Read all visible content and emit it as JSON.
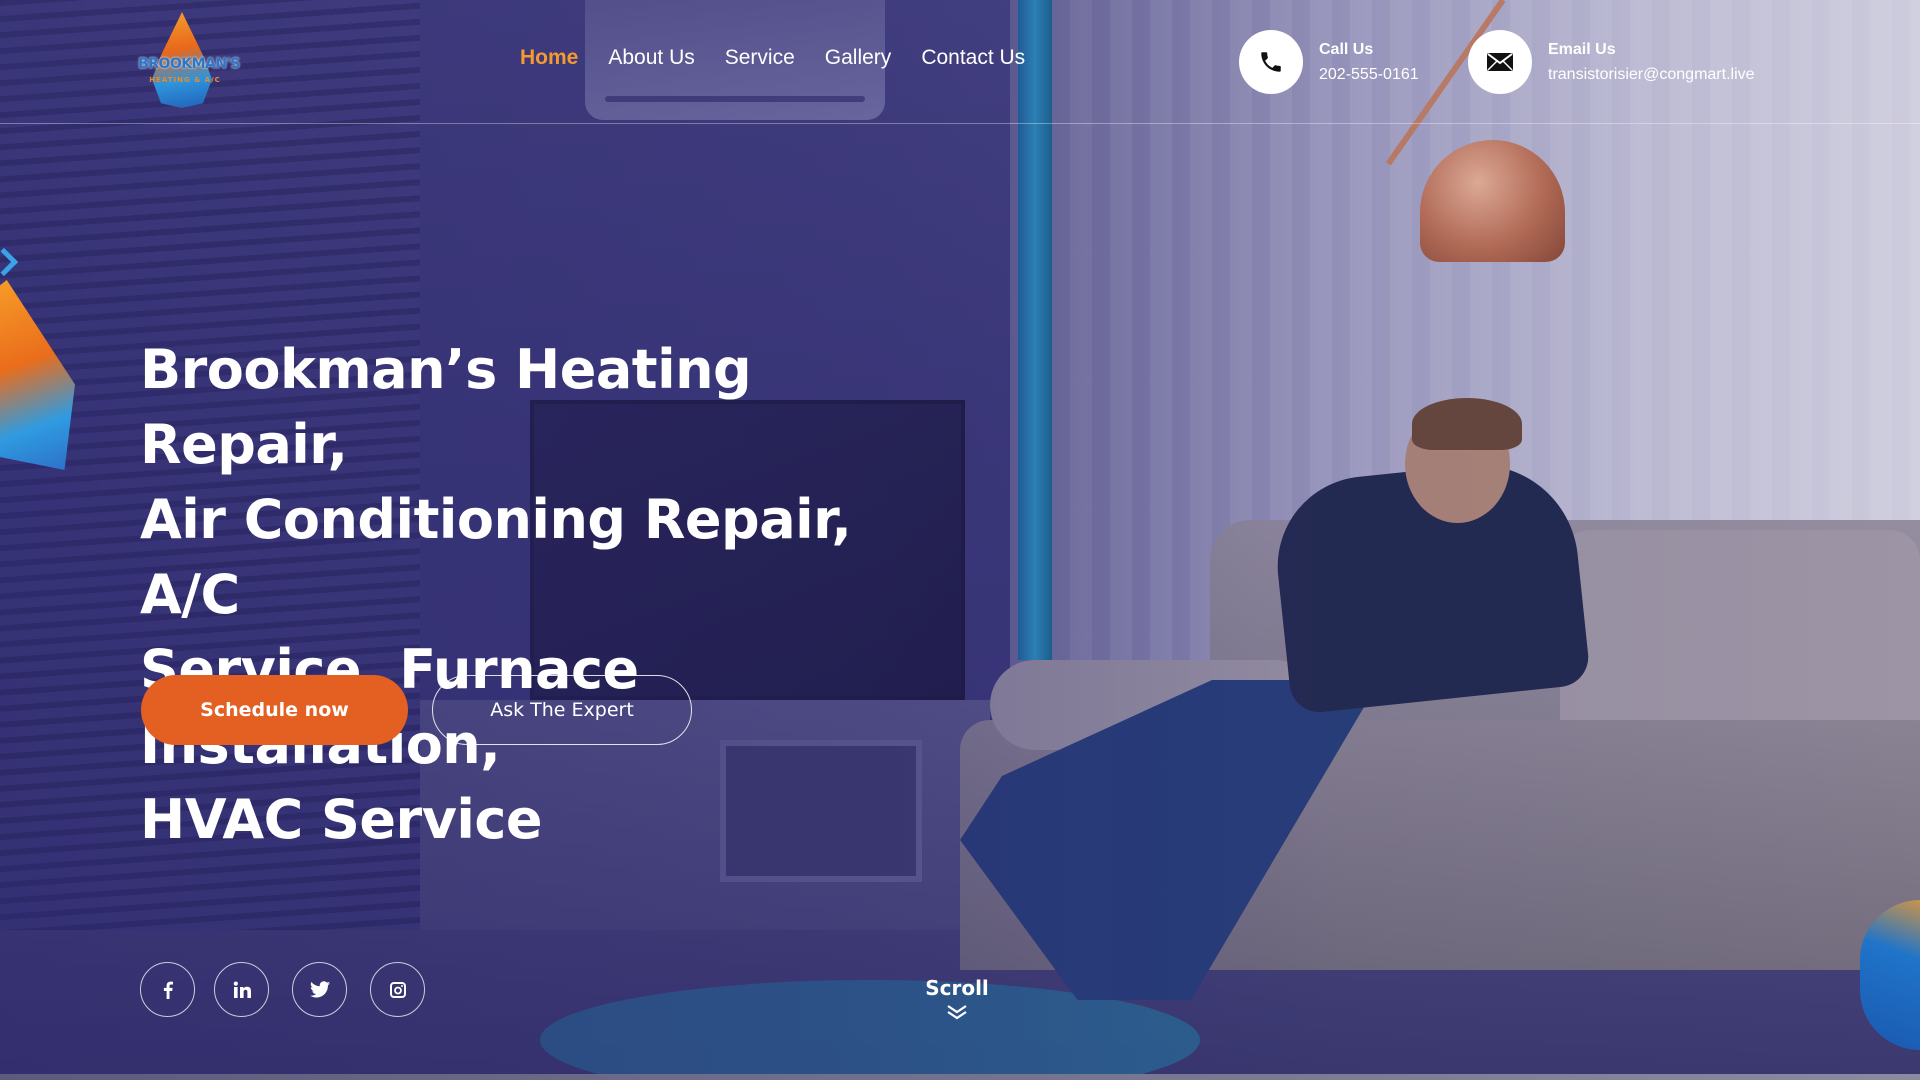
{
  "brand": {
    "logo_text": "BROOKMAN'S",
    "logo_subtext": "HEATING & A/C"
  },
  "nav": {
    "items": [
      {
        "label": "Home",
        "active": true
      },
      {
        "label": "About Us",
        "active": false
      },
      {
        "label": "Service",
        "active": false
      },
      {
        "label": "Gallery",
        "active": false
      },
      {
        "label": "Contact Us",
        "active": false
      }
    ]
  },
  "contact": {
    "call": {
      "label": "Call Us",
      "value": "202-555-0161",
      "icon": "phone-icon"
    },
    "email": {
      "label": "Email Us",
      "value": "transistorisier@congmart.live",
      "icon": "mail-icon"
    }
  },
  "hero": {
    "title_lines": [
      "Brookman’s Heating Repair,",
      "Air Conditioning Repair, A/C",
      "Service, Furnace Installation,",
      "HVAC Service"
    ],
    "primary_button": "Schedule now",
    "secondary_button": "Ask The Expert"
  },
  "socials": [
    {
      "icon": "facebook-icon"
    },
    {
      "icon": "linkedin-icon"
    },
    {
      "icon": "twitter-icon"
    },
    {
      "icon": "instagram-icon"
    }
  ],
  "scroll": {
    "label": "Scroll",
    "icon": "double-chevron-down-icon"
  },
  "colors": {
    "accent": "#f59a2e",
    "primary_button": "#e35f22",
    "overlay": "#2c266e"
  }
}
